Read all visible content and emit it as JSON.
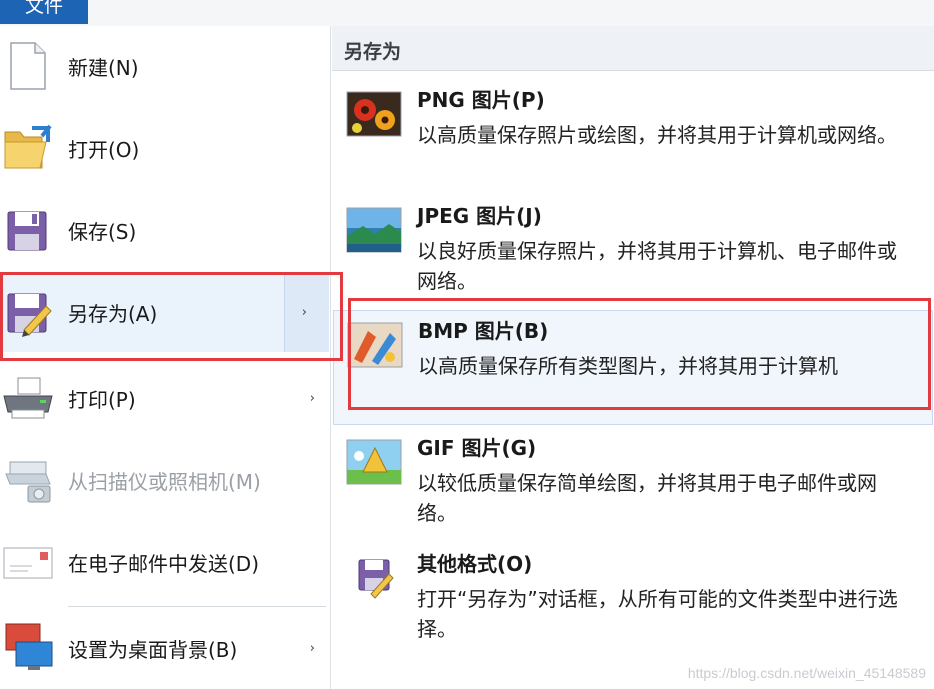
{
  "ribbon": {
    "file_tab_label": "文件"
  },
  "left_menu": {
    "items": [
      {
        "label": "新建(N)",
        "icon": "new-document-icon",
        "has_submenu": false,
        "disabled": false
      },
      {
        "label": "打开(O)",
        "icon": "open-folder-icon",
        "has_submenu": false,
        "disabled": false
      },
      {
        "label": "保存(S)",
        "icon": "save-disk-icon",
        "has_submenu": false,
        "disabled": false
      },
      {
        "label": "另存为(A)",
        "icon": "save-as-icon",
        "has_submenu": true,
        "disabled": false,
        "active": true
      },
      {
        "label": "打印(P)",
        "icon": "printer-icon",
        "has_submenu": true,
        "disabled": false
      },
      {
        "label": "从扫描仪或照相机(M)",
        "icon": "scanner-camera-icon",
        "has_submenu": false,
        "disabled": true
      },
      {
        "label": "在电子邮件中发送(D)",
        "icon": "email-envelope-icon",
        "has_submenu": false,
        "disabled": false
      },
      {
        "label": "设置为桌面背景(B)",
        "icon": "desktop-background-icon",
        "has_submenu": true,
        "disabled": false
      }
    ],
    "submenu_arrow": "›"
  },
  "submenu": {
    "header": "另存为",
    "items": [
      {
        "title": "PNG 图片(P)",
        "desc": "以高质量保存照片或绘图，并将其用于计算机或网络。",
        "icon": "png-flowers-icon"
      },
      {
        "title": "JPEG 图片(J)",
        "desc": "以良好质量保存照片，并将其用于计算机、电子邮件或网络。",
        "icon": "jpeg-landscape-icon"
      },
      {
        "title": "BMP 图片(B)",
        "desc": "以高质量保存所有类型图片，并将其用于计算机",
        "icon": "bmp-paint-icon",
        "highlighted": true
      },
      {
        "title": "GIF 图片(G)",
        "desc": "以较低质量保存简单绘图，并将其用于电子邮件或网络。",
        "icon": "gif-shapes-icon"
      },
      {
        "title": "其他格式(O)",
        "desc": "打开“另存为”对话框，从所有可能的文件类型中进行选择。",
        "icon": "other-formats-icon"
      }
    ]
  },
  "watermark": "https://blog.csdn.net/weixin_45148589",
  "colors": {
    "file_tab": "#1e64b4",
    "annotation_red": "#e23a3f",
    "active_item_bg": "#eaf3fb"
  }
}
